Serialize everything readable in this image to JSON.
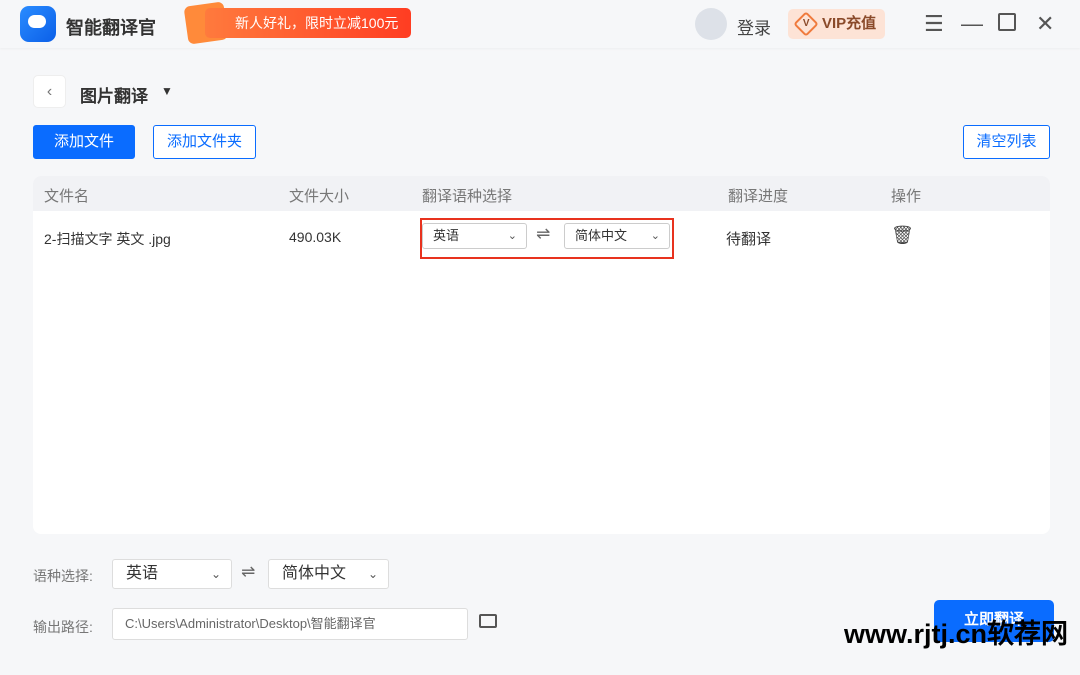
{
  "app": {
    "name": "智能翻译官",
    "promo": "新人好礼，限时立减100元",
    "login": "登录",
    "vip": "VIP充值",
    "vip_icon_letter": "V"
  },
  "header": {
    "mode": "图片翻译"
  },
  "toolbar": {
    "add_file": "添加文件",
    "add_folder": "添加文件夹",
    "clear_list": "清空列表"
  },
  "table": {
    "columns": [
      "文件名",
      "文件大小",
      "翻译语种选择",
      "翻译进度",
      "操作"
    ],
    "rows": [
      {
        "name": "2-扫描文字 英文 .jpg",
        "size": "490.03K",
        "source": "英语",
        "target": "简体中文",
        "status": "待翻译"
      }
    ]
  },
  "bottom": {
    "lang_label": "语种选择:",
    "source": "英语",
    "target": "简体中文",
    "path_label": "输出路径:",
    "path": "C:\\Users\\Administrator\\Desktop\\智能翻译官",
    "translate": "立即翻译"
  },
  "watermark": "www.rjtj.cn软荐网"
}
